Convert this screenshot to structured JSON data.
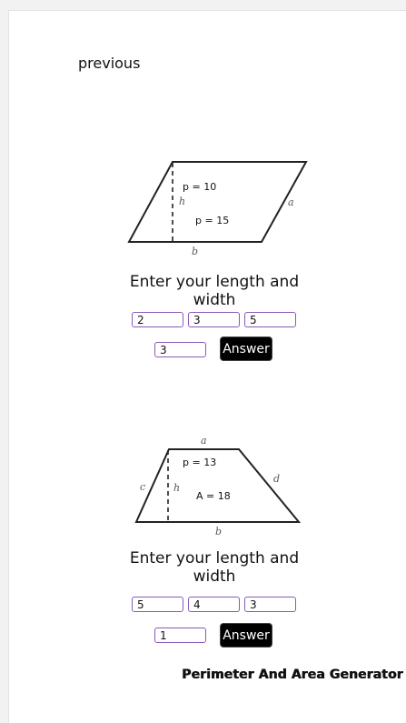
{
  "nav": {
    "previous_label": "previous"
  },
  "parallelogram": {
    "side_labels": {
      "top_side": "a",
      "base": "b",
      "height": "h"
    },
    "readout_1": "p = 10",
    "readout_2": "p = 15",
    "prompt": "Enter your length and width",
    "inputs": [
      "2",
      "3",
      "5",
      "3"
    ],
    "answer_label": "Answer"
  },
  "trapezoid": {
    "side_labels": {
      "top": "a",
      "right": "d",
      "left": "c",
      "base": "b",
      "height": "h"
    },
    "readout_1": "p = 13",
    "readout_2": "A = 18",
    "prompt": "Enter your length and width",
    "inputs": [
      "5",
      "4",
      "3",
      "1"
    ],
    "answer_label": "Answer"
  },
  "footer": {
    "title": "Perimeter And Area Generator"
  },
  "colors": {
    "input_border": "#8a5ab8",
    "button_bg": "#000000"
  }
}
